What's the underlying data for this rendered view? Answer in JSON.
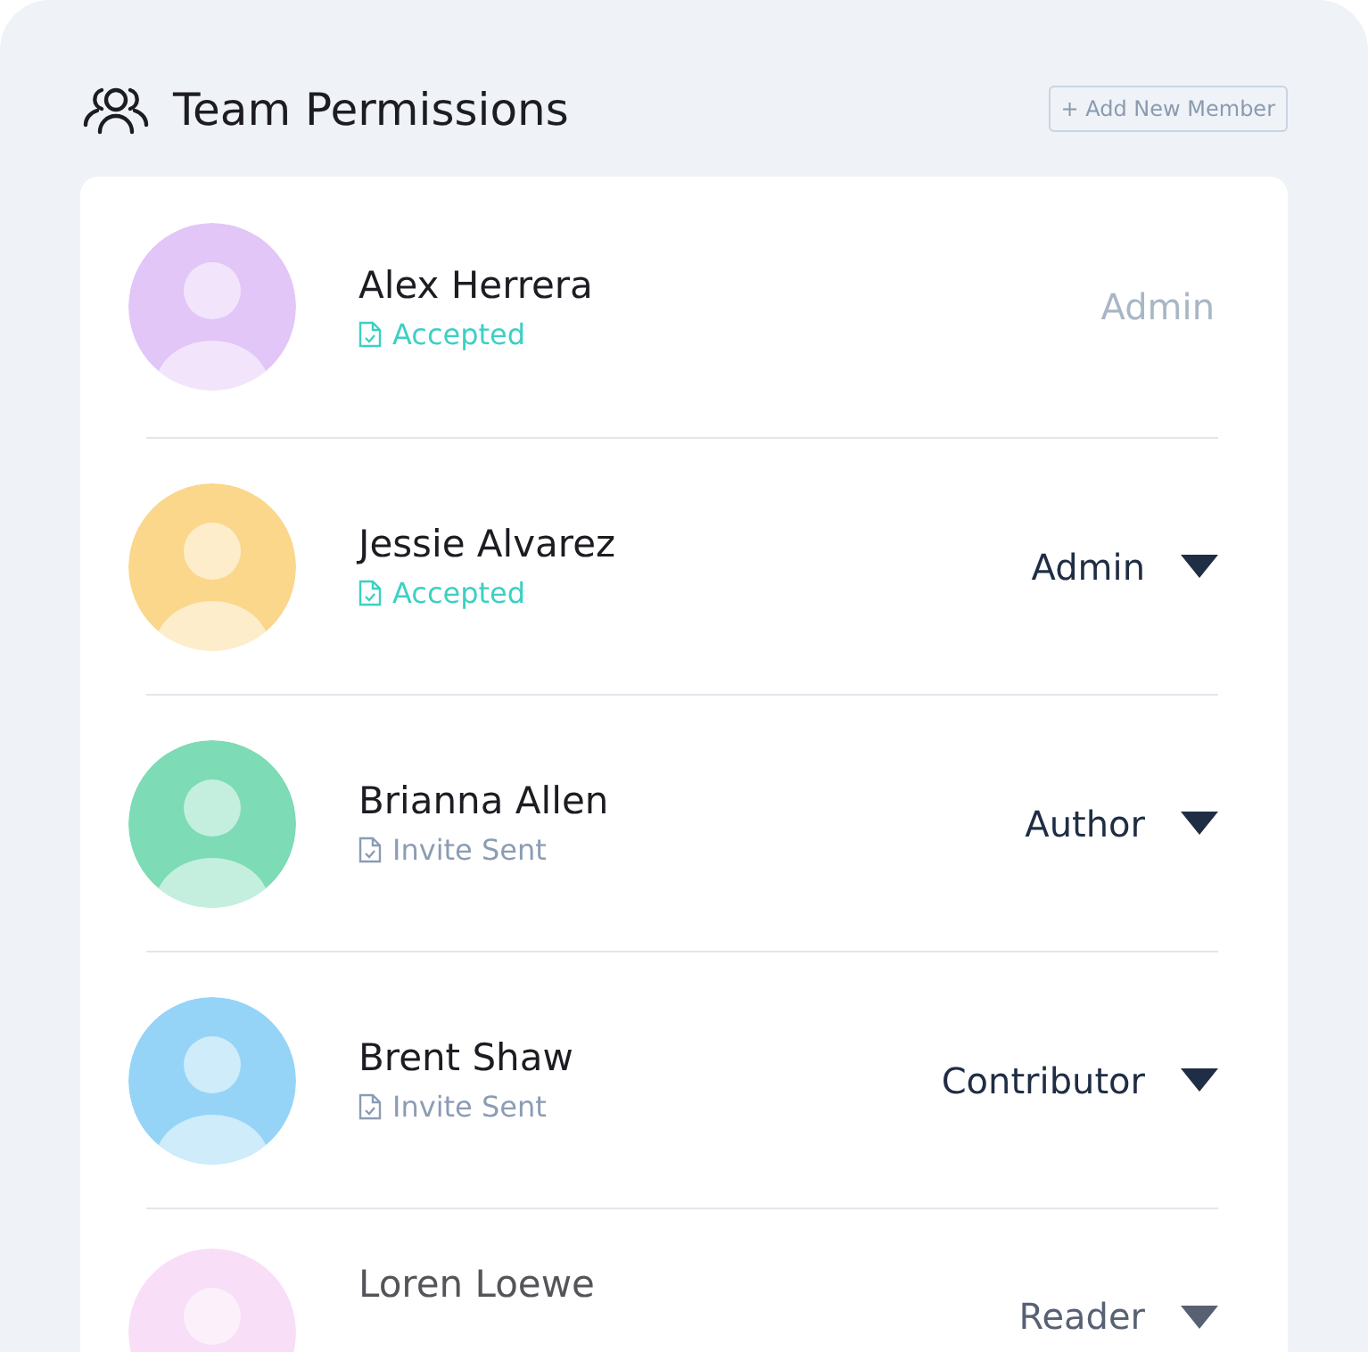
{
  "header": {
    "title": "Team Permissions",
    "add_button": "+ Add New Member"
  },
  "members": [
    {
      "name": "Alex Herrera",
      "status": {
        "label": "Accepted",
        "kind": "accepted"
      },
      "role": "Admin",
      "disabled": true,
      "color": "#e2c6f7"
    },
    {
      "name": "Jessie Alvarez",
      "status": {
        "label": "Accepted",
        "kind": "accepted"
      },
      "role": "Admin",
      "disabled": false,
      "color": "#fbd78c"
    },
    {
      "name": "Brianna Allen",
      "status": {
        "label": "Invite Sent",
        "kind": "sent"
      },
      "role": "Author",
      "disabled": false,
      "color": "#7ddbb6"
    },
    {
      "name": "Brent Shaw",
      "status": {
        "label": "Invite Sent",
        "kind": "sent"
      },
      "role": "Contributor",
      "disabled": false,
      "color": "#96d4f7"
    },
    {
      "name": "Loren Loewe",
      "role": "Reader",
      "disabled": false,
      "color": "#f6d3f4"
    }
  ]
}
